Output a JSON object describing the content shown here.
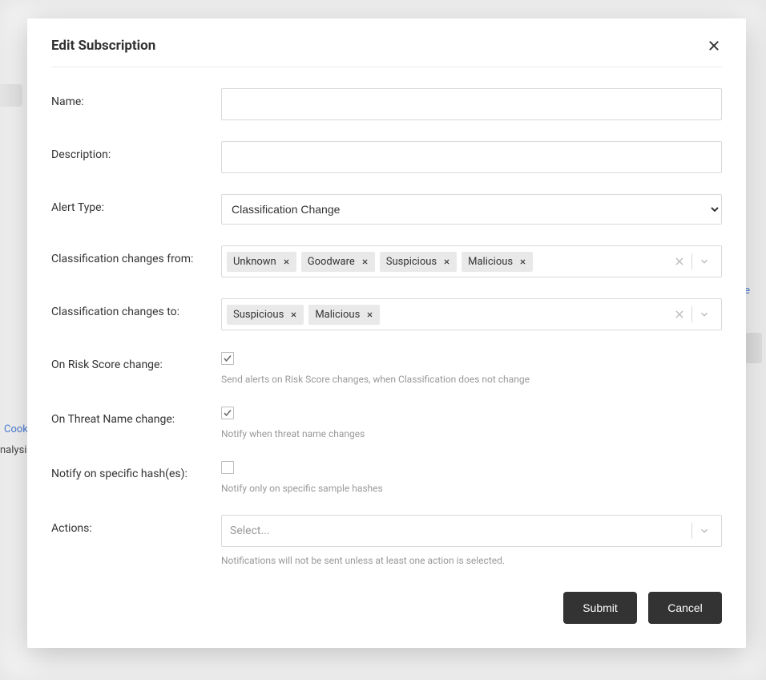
{
  "background": {
    "cook_text": "Cook",
    "nalysis_text": "nalysis",
    "e_text": "e"
  },
  "modal": {
    "title": "Edit Subscription",
    "fields": {
      "name": {
        "label": "Name:",
        "value": ""
      },
      "description": {
        "label": "Description:",
        "value": ""
      },
      "alert_type": {
        "label": "Alert Type:",
        "selected": "Classification Change"
      },
      "changes_from": {
        "label": "Classification changes from:",
        "tags": [
          "Unknown",
          "Goodware",
          "Suspicious",
          "Malicious"
        ]
      },
      "changes_to": {
        "label": "Classification changes to:",
        "tags": [
          "Suspicious",
          "Malicious"
        ]
      },
      "risk_score": {
        "label": "On Risk Score change:",
        "checked": true,
        "helper": "Send alerts on Risk Score changes, when Classification does not change"
      },
      "threat_name": {
        "label": "On Threat Name change:",
        "checked": true,
        "helper": "Notify when threat name changes"
      },
      "specific_hashes": {
        "label": "Notify on specific hash(es):",
        "checked": false,
        "helper": "Notify only on specific sample hashes"
      },
      "actions": {
        "label": "Actions:",
        "placeholder": "Select...",
        "helper": "Notifications will not be sent unless at least one action is selected."
      }
    },
    "buttons": {
      "submit": "Submit",
      "cancel": "Cancel"
    }
  }
}
